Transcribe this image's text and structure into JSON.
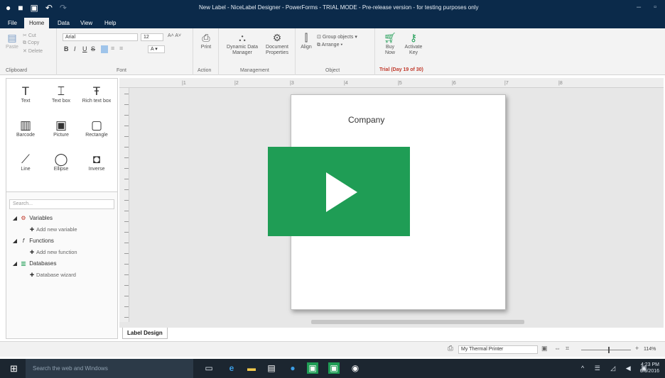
{
  "window": {
    "title": "New Label - NiceLabel Designer - PowerForms - TRIAL MODE - Pre-release version - for testing purposes only",
    "controls": [
      "–",
      "▫",
      "×"
    ]
  },
  "tabs": [
    "File",
    "Home",
    "Data",
    "View",
    "Help"
  ],
  "ribbon": {
    "clipboard": {
      "paste": "Paste",
      "cut": "Cut",
      "copy": "Copy",
      "delete": "Delete",
      "label": "Clipboard"
    },
    "font": {
      "family": "Arial",
      "size": "12",
      "bold": "B",
      "italic": "I",
      "underline": "U",
      "strike": "S",
      "color": "A",
      "label": "Font"
    },
    "action": {
      "print": "Print",
      "label": "Action"
    },
    "management": {
      "dynamic_data_manager": "Dynamic Data Manager",
      "document_properties": "Document Properties",
      "label": "Management"
    },
    "object": {
      "align": "Align",
      "group_objects": "Group objects",
      "arrange": "Arrange",
      "label": "Object"
    },
    "trial": {
      "buy_now": "Buy Now",
      "activate_key": "Activate Key",
      "status": "Trial (Day 19 of 30)"
    }
  },
  "objects": [
    {
      "icon": "T",
      "label": "Text"
    },
    {
      "icon": "⌶",
      "label": "Text box"
    },
    {
      "icon": "Ŧ",
      "label": "Rich text box"
    },
    {
      "icon": "▥",
      "label": "Barcode"
    },
    {
      "icon": "▣",
      "label": "Picture"
    },
    {
      "icon": "▢",
      "label": "Rectangle"
    },
    {
      "icon": "⟋",
      "label": "Line"
    },
    {
      "icon": "◯",
      "label": "Ellipse"
    },
    {
      "icon": "◘",
      "label": "Inverse"
    }
  ],
  "datasource": {
    "search_placeholder": "Search...",
    "variables": "Variables",
    "add_variable": "Add new variable",
    "functions": "Functions",
    "add_function": "Add new function",
    "databases": "Databases",
    "database_wizard": "Database wizard"
  },
  "ruler": {
    "ticks": [
      "|1",
      "|2",
      "|3",
      "|4",
      "|5",
      "|6",
      "|7",
      "|8"
    ]
  },
  "label": {
    "company": "Company"
  },
  "label_tab": "Label Design",
  "status": {
    "printer": "My Thermal Printer",
    "zoom": "114%"
  },
  "taskbar": {
    "search_placeholder": "Search the web and Windows",
    "time": "4:23 PM",
    "date": "6/6/2016"
  },
  "colors": {
    "title_bar": "#0b2a4a",
    "play_overlay": "#1f9d55",
    "trial_text": "#c0392b"
  }
}
